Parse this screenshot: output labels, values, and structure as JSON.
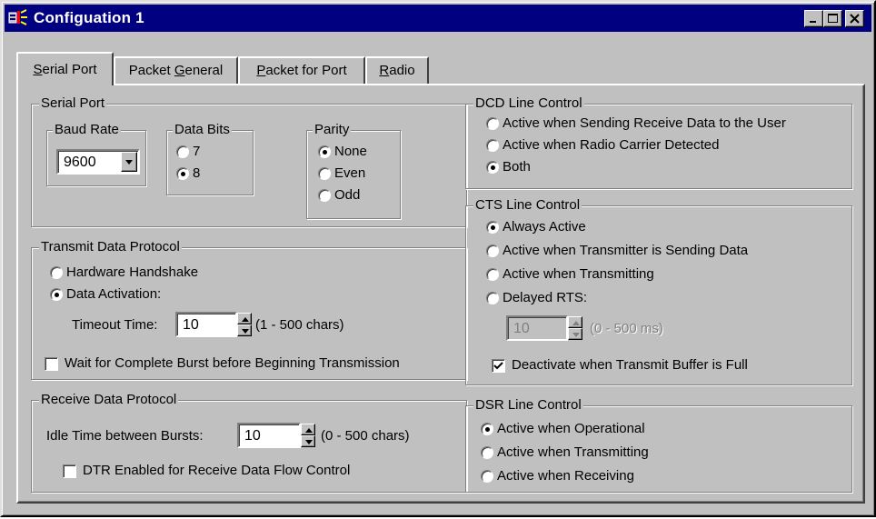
{
  "window": {
    "title": "Configuation 1",
    "buttons": {
      "minimize": "minimize",
      "maximize": "maximize",
      "close": "close"
    }
  },
  "tabs": [
    {
      "label_pre": "",
      "label_u": "S",
      "label_post": "erial Port",
      "active": true
    },
    {
      "label_pre": "Packet ",
      "label_u": "G",
      "label_post": "eneral",
      "active": false
    },
    {
      "label_pre": "",
      "label_u": "P",
      "label_post": "acket for Port",
      "active": false
    },
    {
      "label_pre": "",
      "label_u": "R",
      "label_post": "adio",
      "active": false
    }
  ],
  "serial_port": {
    "title": "Serial Port",
    "baud_rate": {
      "title": "Baud Rate",
      "value": "9600"
    },
    "data_bits": {
      "title": "Data Bits",
      "options": [
        "7",
        "8"
      ],
      "selected": "8"
    },
    "parity": {
      "title": "Parity",
      "options": [
        "None",
        "Even",
        "Odd"
      ],
      "selected": "None"
    }
  },
  "transmit": {
    "title": "Transmit Data Protocol",
    "options": [
      "Hardware Handshake",
      "Data Activation:"
    ],
    "selected": "Data Activation:",
    "timeout_label": "Timeout Time:",
    "timeout_value": "10",
    "timeout_range": "(1 - 500 chars)",
    "wait_label": "Wait for Complete Burst before Beginning Transmission",
    "wait_checked": false
  },
  "receive": {
    "title": "Receive Data Protocol",
    "idle_label": "Idle Time between Bursts:",
    "idle_value": "10",
    "idle_range": "(0 - 500 chars)",
    "dtr_label": "DTR Enabled for Receive Data Flow Control",
    "dtr_checked": false
  },
  "dcd": {
    "title": "DCD Line Control",
    "options": [
      "Active when Sending Receive Data to the User",
      "Active when Radio Carrier Detected",
      "Both"
    ],
    "selected": "Both"
  },
  "cts": {
    "title": "CTS Line Control",
    "options": [
      "Always Active",
      "Active when Transmitter is Sending Data",
      "Active when Transmitting",
      "Delayed RTS:"
    ],
    "selected": "Always Active",
    "delay_value": "10",
    "delay_range": "(0 - 500 ms)",
    "deactivate_label": "Deactivate when Transmit Buffer is Full",
    "deactivate_checked": true
  },
  "dsr": {
    "title": "DSR Line Control",
    "options": [
      "Active when Operational",
      "Active when Transmitting",
      "Active when Receiving"
    ],
    "selected": "Active when Operational"
  }
}
